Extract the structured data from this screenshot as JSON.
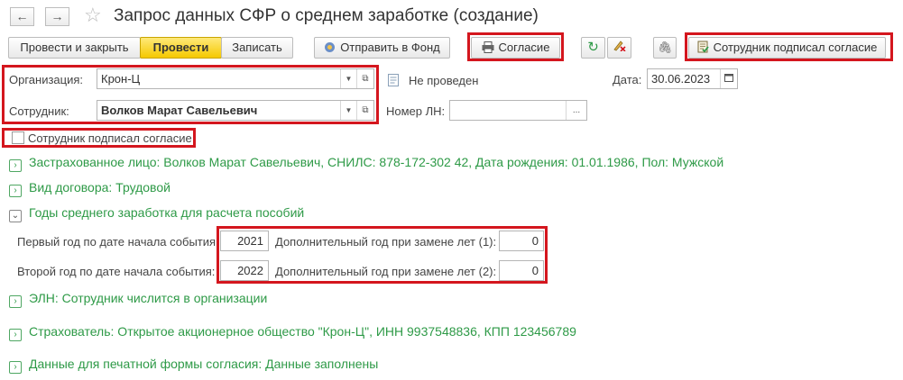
{
  "window": {
    "title": "Запрос данных СФР о среднем заработке (создание)"
  },
  "toolbar": {
    "post_close": "Провести и закрыть",
    "post": "Провести",
    "save": "Записать",
    "send_fund": "Отправить в Фонд",
    "consent": "Согласие",
    "employee_signed": "Сотрудник подписал согласие"
  },
  "form": {
    "org_label": "Организация:",
    "org_value": "Крон-Ц",
    "employee_label": "Сотрудник:",
    "employee_value": "Волков Марат Савельевич",
    "status": "Не проведен",
    "date_label": "Дата:",
    "date_value": "30.06.2023",
    "ln_label": "Номер ЛН:",
    "ln_value": "",
    "consent_checkbox": "Сотрудник подписал согласие"
  },
  "groups": {
    "insured": "Застрахованное лицо: Волков Марат Савельевич, СНИЛС: 878-172-302 42, Дата рождения: 01.01.1986, Пол: Мужской",
    "contract": "Вид договора: Трудовой",
    "years": "Годы среднего заработка для расчета пособий",
    "eln": "ЭЛН: Сотрудник числится в организации",
    "insurer": "Страхователь: Открытое акционерное общество \"Крон-Ц\", ИНН 9937548836, КПП 123456789",
    "print_data": "Данные для печатной формы согласия: Данные заполнены"
  },
  "years": {
    "first_label": "Первый год по дате начала события:",
    "first_value": "2021",
    "extra1_label": "Дополнительный год при замене лет (1):",
    "extra1_value": "0",
    "second_label": "Второй год по дате начала события:",
    "second_value": "2022",
    "extra2_label": "Дополнительный год при замене лет (2):",
    "extra2_value": "0"
  }
}
